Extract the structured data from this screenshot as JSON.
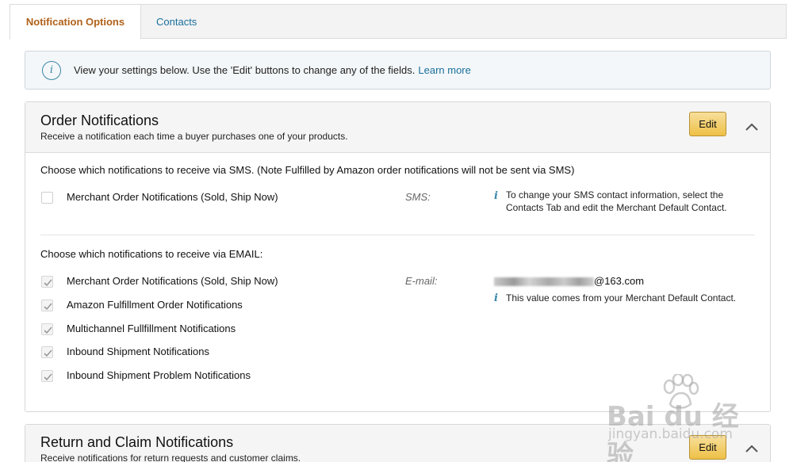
{
  "tabs": {
    "notification_options": "Notification Options",
    "contacts": "Contacts"
  },
  "info": {
    "icon": "info-icon",
    "text": "View your settings below. Use the 'Edit' buttons to change any of the fields.",
    "link": "Learn more"
  },
  "order_panel": {
    "title": "Order Notifications",
    "subtitle": "Receive a notification each time a buyer purchases one of your products.",
    "edit_label": "Edit",
    "sms": {
      "heading": "Choose which notifications to receive via SMS. (Note Fulfilled by Amazon order notifications will not be sent via SMS)",
      "option": "Merchant Order Notifications (Sold, Ship Now)",
      "checked": false,
      "field_label": "SMS:",
      "note_line1": "To change your SMS contact information, select the",
      "note_line2": "Contacts Tab and edit the Merchant Default Contact."
    },
    "email": {
      "heading": "Choose which notifications to receive via EMAIL:",
      "options": [
        "Merchant Order Notifications (Sold, Ship Now)",
        "Amazon Fulfillment Order Notifications",
        "Multichannel Fullfillment Notifications",
        "Inbound Shipment Notifications",
        "Inbound Shipment Problem Notifications"
      ],
      "checked": true,
      "field_label": "E-mail:",
      "address_domain": "@163.com",
      "note": "This value comes from your Merchant Default Contact."
    }
  },
  "return_panel": {
    "title": "Return and Claim Notifications",
    "subtitle": "Receive notifications for return requests and customer claims.",
    "edit_label": "Edit"
  },
  "watermark": {
    "brand": "Bai du 经验",
    "url": "jingyan.baidu.com"
  },
  "colors": {
    "active_tab": "#b0611a",
    "link": "#1a6f9c",
    "edit_button": "#f0c14b"
  }
}
